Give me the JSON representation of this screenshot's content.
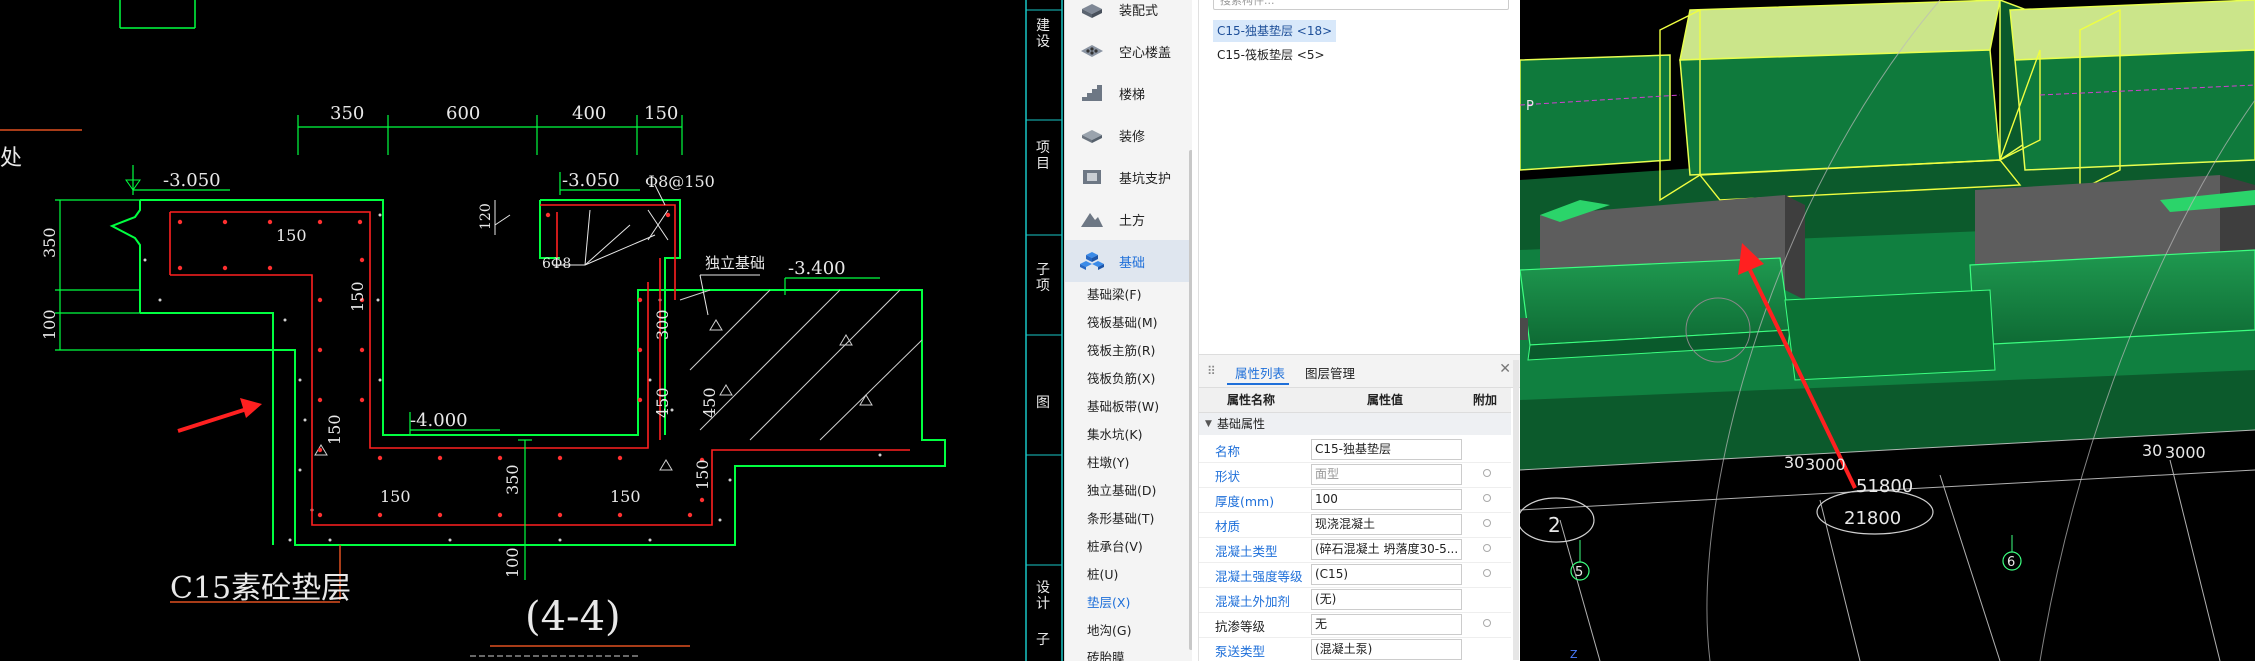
{
  "drawing": {
    "dims_top": [
      "350",
      "600",
      "400",
      "150"
    ],
    "elev_left": "-3.050",
    "elev_mid": "-3.050",
    "rebar_label": "Φ8@150",
    "elev_right": "-3.400",
    "elev_bottom": "-4.000",
    "dim_350_left": "350",
    "dim_100_left": "100",
    "dim_150_a": "150",
    "dim_150_b": "150",
    "dim_150_c": "150",
    "dim_120": "120",
    "stirrup_label": "6Φ8",
    "existing_label": "独立基础",
    "dim_300": "300",
    "dim_450_a": "450",
    "dim_450_b": "450",
    "dim_150_bottom_a": "150",
    "dim_150_bottom_b": "150",
    "dim_350_bottom": "350",
    "dim_150_right": "150",
    "dim_100_bottom": "100",
    "pad_label": "C15素砼垫层",
    "section_label": "(4-4)",
    "left_char": "处"
  },
  "strip": {
    "chars": [
      "建设",
      "项目",
      "子项",
      "图",
      "设计",
      "子"
    ]
  },
  "nav": {
    "items": [
      {
        "label": "装配式",
        "icon": "prefab-icon"
      },
      {
        "label": "空心楼盖",
        "icon": "hollow-floor-icon"
      },
      {
        "label": "楼梯",
        "icon": "stairs-icon"
      },
      {
        "label": "装修",
        "icon": "decoration-icon"
      },
      {
        "label": "基坑支护",
        "icon": "pit-support-icon"
      },
      {
        "label": "土方",
        "icon": "earthwork-icon"
      },
      {
        "label": "基础",
        "icon": "foundation-icon"
      }
    ],
    "sub_items": [
      "基础梁(F)",
      "筏板基础(M)",
      "筏板主筋(R)",
      "筏板负筋(X)",
      "基础板带(W)",
      "集水坑(K)",
      "柱墩(Y)",
      "独立基础(D)",
      "条形基础(T)",
      "桩承台(V)",
      "桩(U)",
      "垫层(X)",
      "地沟(G)",
      "砖胎膜"
    ]
  },
  "panel": {
    "search_placeholder": "搜索构件...",
    "layers": [
      "C15-独基垫层 <18>",
      "C15-筏板垫层 <5>"
    ],
    "tabs": [
      "属性列表",
      "图层管理"
    ],
    "columns": [
      "属性名称",
      "属性值",
      "附加"
    ],
    "group": "基础属性",
    "rows": [
      {
        "name": "名称",
        "value": "C15-独基垫层",
        "blue": true,
        "dot": false,
        "gray": false
      },
      {
        "name": "形状",
        "value": "面型",
        "blue": true,
        "dot": true,
        "gray": true
      },
      {
        "name": "厚度(mm)",
        "value": "100",
        "blue": true,
        "dot": true,
        "gray": false
      },
      {
        "name": "材质",
        "value": "现浇混凝土",
        "blue": true,
        "dot": true,
        "gray": false
      },
      {
        "name": "混凝土类型",
        "value": "(碎石混凝土 坍落度30-5...",
        "blue": true,
        "dot": true,
        "gray": false
      },
      {
        "name": "混凝土强度等级",
        "value": "(C15)",
        "blue": true,
        "dot": true,
        "gray": false
      },
      {
        "name": "混凝土外加剂",
        "value": "(无)",
        "blue": true,
        "dot": false,
        "gray": false
      },
      {
        "name": "抗渗等级",
        "value": "无",
        "blue": false,
        "dot": true,
        "gray": false
      },
      {
        "name": "泵送类型",
        "value": "(混凝土泵)",
        "blue": true,
        "dot": false,
        "gray": false
      }
    ]
  },
  "view3d": {
    "dim_left": "3000",
    "dim_left_small": "30",
    "dim_mid": "51800",
    "dim_mid2": "21800",
    "dim_right": "3000",
    "dim_right_small": "30",
    "axis_a": "5",
    "axis_b": "6",
    "axis_c": "2",
    "corner_p": "P",
    "corner_z": "Z"
  }
}
